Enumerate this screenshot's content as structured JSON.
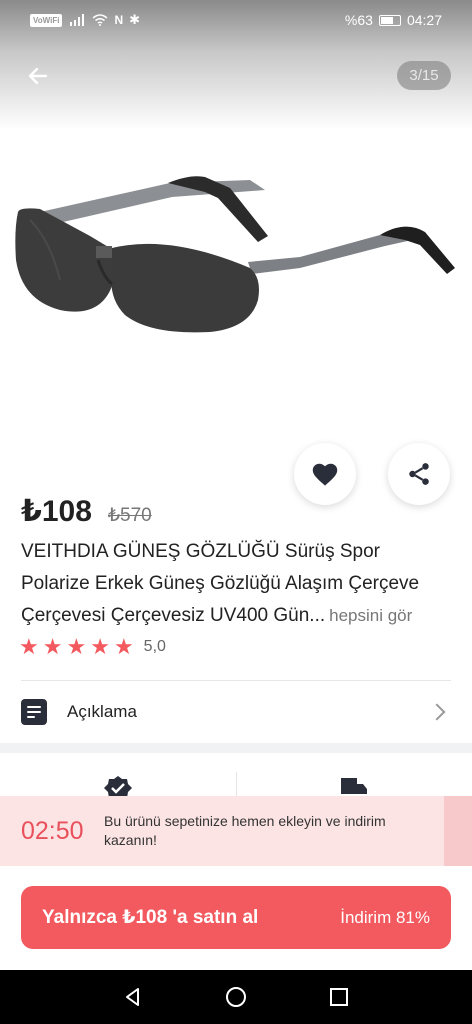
{
  "status_bar": {
    "wifi_badge": "VoWiFi",
    "battery_percent": "%63",
    "time": "04:27"
  },
  "gallery": {
    "counter": "3/15"
  },
  "product": {
    "price_current": "₺108",
    "price_old": "₺570",
    "title_line1": "VEITHDIA GÜNEŞ GÖZLÜĞÜ Sürüş Spor",
    "title_line2": "Polarize Erkek Güneş Gözlüğü Alaşım Çerçeve",
    "title_line3": "Çerçevesi Çerçevesiz UV400 Gün...",
    "see_all": "hepsini gör",
    "rating_value": "5,0",
    "stars": 5
  },
  "description": {
    "label": "Açıklama"
  },
  "timer": {
    "value": "02:50",
    "text": "Bu ürünü sepetinize hemen ekleyin ve indirim kazanın!"
  },
  "buy": {
    "label": "Yalnızca ₺108 'a satın al",
    "discount": "İndirim 81%"
  },
  "colors": {
    "accent": "#f35a5f",
    "timer_bg": "#fde4e4"
  }
}
